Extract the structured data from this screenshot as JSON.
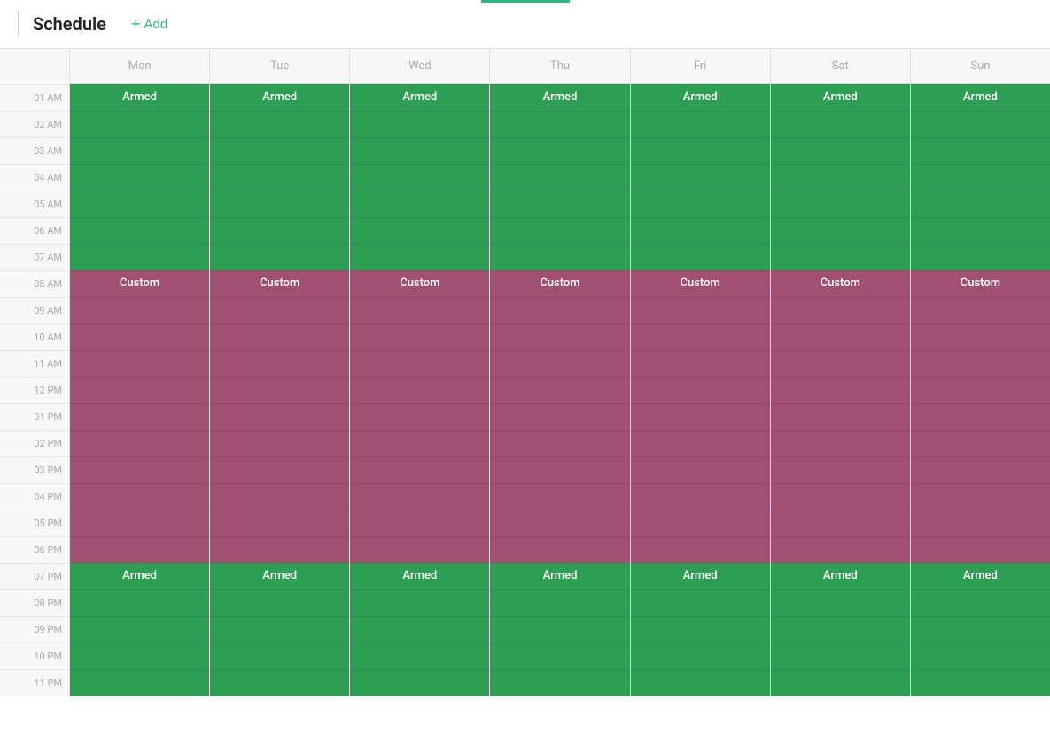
{
  "header": {
    "title": "Schedule",
    "add_label": "Add",
    "add_plus": "+"
  },
  "days": {
    "headers": [
      "Mon",
      "Tue",
      "Wed",
      "Thu",
      "Fri",
      "Sat",
      "Sun"
    ]
  },
  "times": [
    "01 AM",
    "02 AM",
    "03 AM",
    "04 AM",
    "05 AM",
    "06 AM",
    "07 AM",
    "08 AM",
    "09 AM",
    "10 AM",
    "11 AM",
    "12 PM",
    "01 PM",
    "02 PM",
    "03 PM",
    "04 PM",
    "05 PM",
    "06 PM",
    "07 PM",
    "08 PM",
    "09 PM",
    "10 PM",
    "11 PM"
  ],
  "blocks": {
    "armed_label": "Armed",
    "custom_label": "Custom",
    "armed_color": "#2e9e55",
    "custom_color": "#a05070",
    "armed_morning_start": 0,
    "armed_morning_end": 7,
    "custom_start": 7,
    "custom_end": 18,
    "armed_evening_start": 18,
    "armed_evening_end": 23
  },
  "colors": {
    "accent": "#2bbb7e",
    "armed": "#2e9e55",
    "custom": "#a05070",
    "header_bg": "#f7f7f7",
    "border": "#e0e0e0",
    "time_text": "#aaa",
    "day_text": "#aaa"
  }
}
